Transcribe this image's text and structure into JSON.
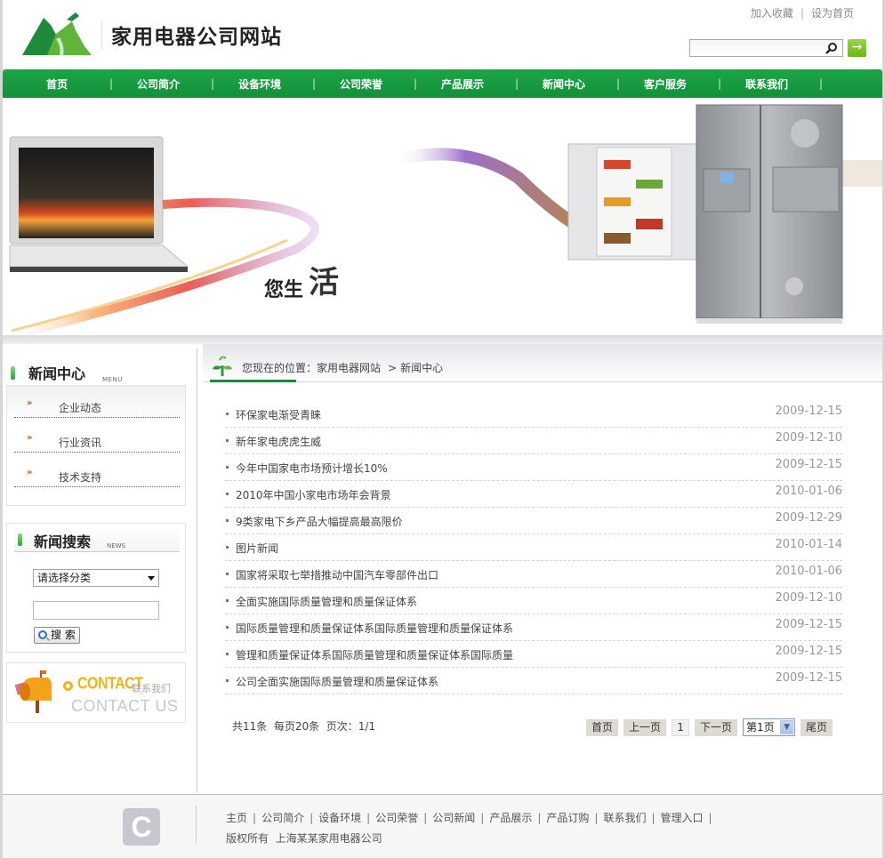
{
  "header": {
    "site_title": "家用电器公司网站",
    "top_links": [
      "加入收藏",
      "设为首页"
    ],
    "search": {
      "value": "",
      "placeholder": ""
    },
    "search_go_icon": "arrow-right-icon"
  },
  "nav": {
    "items": [
      "首页",
      "公司简介",
      "设备环境",
      "公司荣誉",
      "产品展示",
      "新闻中心",
      "客户服务",
      "联系我们"
    ],
    "separator": "|"
  },
  "banner": {
    "slogan_a": "您生",
    "slogan_b": "活"
  },
  "sidebar": {
    "news_center": {
      "title": "新闻中心",
      "en": "MENU",
      "items": [
        "企业动态",
        "行业资讯",
        "技术支持"
      ],
      "bullet": "»"
    },
    "news_search": {
      "title": "新闻搜索",
      "en": "NEWS",
      "category_selected": "请选择分类",
      "keyword_value": "",
      "button_label": "搜 索"
    },
    "contact": {
      "word": "CONTACT",
      "cn": "联系我们",
      "en": "CONTACT US"
    }
  },
  "breadcrumb": {
    "prefix": "您现在的位置：",
    "home": "家用电器网站",
    "separator": ">",
    "current": "新闻中心"
  },
  "news": [
    {
      "title": "环保家电渐受青睐",
      "date": "2009-12-15"
    },
    {
      "title": "新年家电虎虎生威",
      "date": "2009-12-10"
    },
    {
      "title": "今年中国家电市场预计增长10%",
      "date": "2009-12-15"
    },
    {
      "title": "2010年中国小家电市场年会背景",
      "date": "2010-01-06"
    },
    {
      "title": "9类家电下乡产品大幅提高最高限价",
      "date": "2009-12-29"
    },
    {
      "title": "图片新闻",
      "date": "2010-01-14"
    },
    {
      "title": "国家将采取七举措推动中国汽车零部件出口",
      "date": "2010-01-06"
    },
    {
      "title": "全面实施国际质量管理和质量保证体系",
      "date": "2009-12-10"
    },
    {
      "title": "国际质量管理和质量保证体系国际质量管理和质量保证体系",
      "date": "2009-12-15"
    },
    {
      "title": "管理和质量保证体系国际质量管理和质量保证体系国际质量",
      "date": "2009-12-15"
    },
    {
      "title": "公司全面实施国际质量管理和质量保证体系",
      "date": "2009-12-15"
    }
  ],
  "pager": {
    "summary": "共11条  每页20条  页次：1/1",
    "first": "首页",
    "prev": "上一页",
    "current": "1",
    "next": "下一页",
    "select_value": "第1页",
    "last": "尾页"
  },
  "footer": {
    "logo_letter": "C",
    "links": [
      "主页",
      "公司简介",
      "设备环境",
      "公司荣誉",
      "公司新闻",
      "产品展示",
      "产品订购",
      "联系我们",
      "管理入口"
    ],
    "copyright": "版权所有  上海某某家用电器公司"
  }
}
